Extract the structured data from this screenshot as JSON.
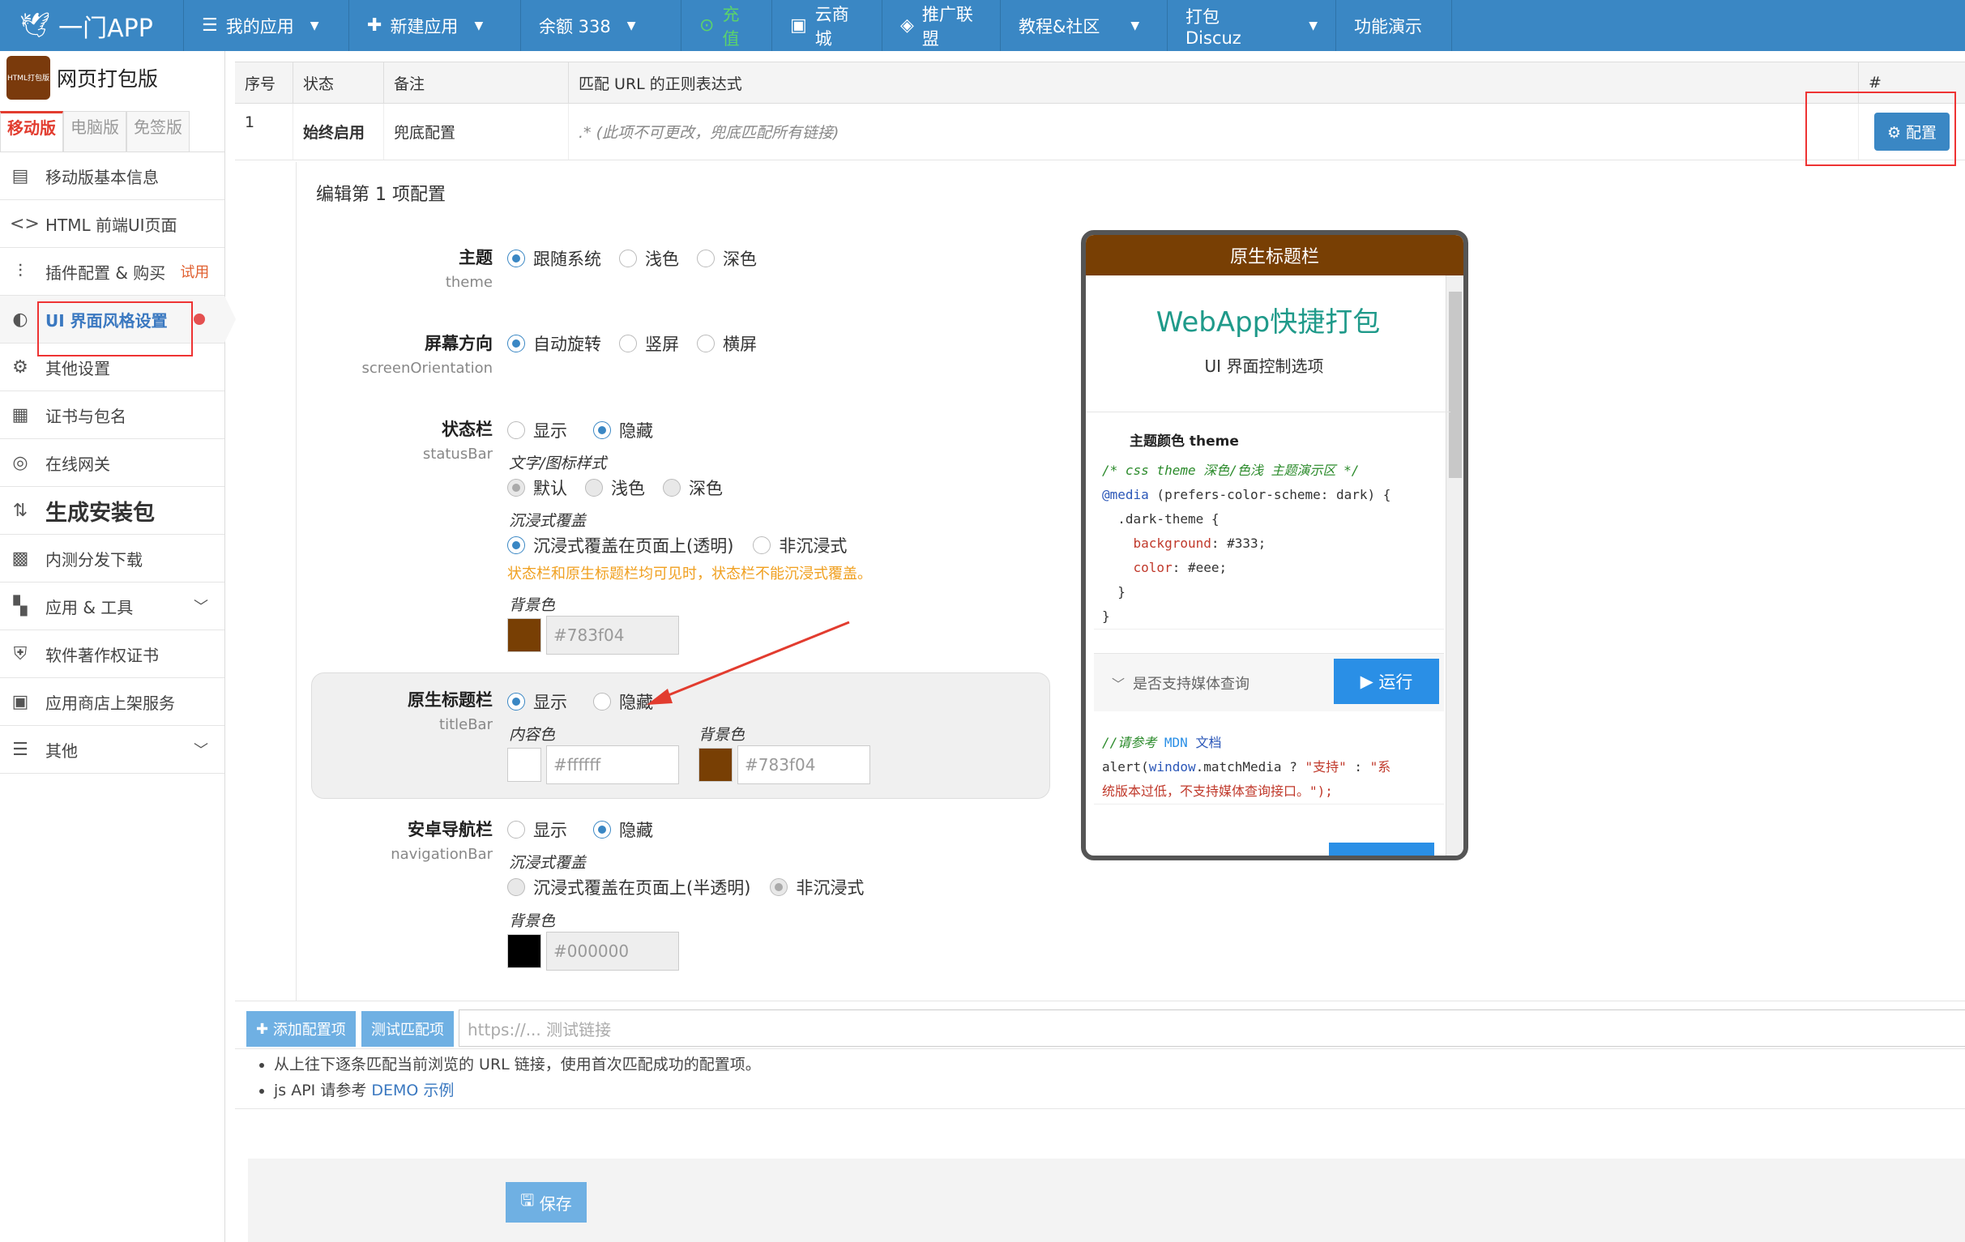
{
  "topnav": {
    "brand": "一门APP",
    "items": [
      {
        "label": "我的应用",
        "icon": "list-icon"
      },
      {
        "label": "新建应用",
        "icon": "plus-icon"
      },
      {
        "label": "余额 338",
        "icon": ""
      },
      {
        "label": "充值",
        "icon": "recharge-icon"
      },
      {
        "label": "云商城",
        "icon": "shop-icon"
      },
      {
        "label": "推广联盟",
        "icon": "diamond-icon"
      },
      {
        "label": "教程&社区",
        "icon": ""
      },
      {
        "label": "打包 Discuz",
        "icon": ""
      },
      {
        "label": "功能演示",
        "icon": ""
      }
    ]
  },
  "sidebar": {
    "app_logo_text": "HTML打包版",
    "app_title": "网页打包版",
    "version_tabs": [
      "移动版",
      "电脑版",
      "免签版"
    ],
    "items": [
      {
        "label": "移动版基本信息",
        "icon": "document-icon"
      },
      {
        "label": "HTML 前端UI页面",
        "icon": "code-icon"
      },
      {
        "label": "插件配置 & 购买",
        "icon": "sliders-icon",
        "badge": "试用"
      },
      {
        "label": "UI 界面风格设置",
        "icon": "palette-icon"
      },
      {
        "label": "其他设置",
        "icon": "gear-icon"
      },
      {
        "label": "证书与包名",
        "icon": "certificate-icon"
      },
      {
        "label": "在线网关",
        "icon": "gateway-icon"
      },
      {
        "label": "生成安装包",
        "icon": "sort-icon"
      },
      {
        "label": "内测分发下载",
        "icon": "qrcode-icon"
      },
      {
        "label": "应用 & 工具",
        "icon": "grid-icon"
      },
      {
        "label": "软件著作权证书",
        "icon": "shield-icon"
      },
      {
        "label": "应用商店上架服务",
        "icon": "store-icon"
      },
      {
        "label": "其他",
        "icon": "menu-icon"
      }
    ]
  },
  "table": {
    "headers": [
      "序号",
      "状态",
      "备注",
      "匹配 URL 的正则表达式",
      "#"
    ],
    "row": {
      "index": "1",
      "status": "始终启用",
      "remark": "兜底配置",
      "regex": ".* (此项不可更改，兜底匹配所有链接)",
      "action": "配置"
    }
  },
  "editor": {
    "title": "编辑第 1 项配置",
    "theme": {
      "label": "主题",
      "key": "theme",
      "options": [
        "跟随系统",
        "浅色",
        "深色"
      ],
      "selected": 0
    },
    "orientation": {
      "label": "屏幕方向",
      "key": "screenOrientation",
      "options": [
        "自动旋转",
        "竖屏",
        "横屏"
      ],
      "selected": 0
    },
    "statusbar": {
      "label": "状态栏",
      "key": "statusBar",
      "options": [
        "显示",
        "隐藏"
      ],
      "selected": 1,
      "text_style_label": "文字/图标样式",
      "text_style_options": [
        "默认",
        "浅色",
        "深色"
      ],
      "immersive_label": "沉浸式覆盖",
      "immersive_options": [
        "沉浸式覆盖在页面上(透明)",
        "非沉浸式"
      ],
      "warning": "状态栏和原生标题栏均可见时，状态栏不能沉浸式覆盖。",
      "bg_label": "背景色",
      "bg_value": "#783f04",
      "bg_color": "#783f04"
    },
    "titlebar": {
      "label": "原生标题栏",
      "key": "titleBar",
      "options": [
        "显示",
        "隐藏"
      ],
      "selected": 0,
      "content_label": "内容色",
      "content_value": "#ffffff",
      "content_color": "#ffffff",
      "bg_label": "背景色",
      "bg_value": "#783f04",
      "bg_color": "#783f04"
    },
    "navbar": {
      "label": "安卓导航栏",
      "key": "navigationBar",
      "options": [
        "显示",
        "隐藏"
      ],
      "selected": 1,
      "immersive_label": "沉浸式覆盖",
      "immersive_options": [
        "沉浸式覆盖在页面上(半透明)",
        "非沉浸式"
      ],
      "bg_label": "背景色",
      "bg_value": "#000000",
      "bg_color": "#000000"
    }
  },
  "preview": {
    "titlebar": "原生标题栏",
    "heading": "WebApp快捷打包",
    "subheading": "UI 界面控制选项",
    "section": "主题颜色 theme",
    "code1": {
      "c1": "/* css theme 深色/色浅 主题演示区 */",
      "c2a": "@media",
      "c2b": " (prefers-color-scheme: dark) {",
      "c3": "  .dark-theme {",
      "c4a": "    background",
      "c4b": ": #333;",
      "c5a": "    color",
      "c5b": ": #eee;",
      "c6": "  }",
      "c7": "}"
    },
    "media_query_label": "是否支持媒体查询",
    "run_label": "运行",
    "code2": {
      "c1a": "//请参考 ",
      "c1b": "MDN",
      "c1c": " 文档",
      "c2a": "alert(",
      "c2b": "window",
      "c2c": ".matchMedia ? ",
      "c2d": "\"支持\"",
      "c2e": " : ",
      "c2f": "\"系",
      "c3": "统版本过低，不支持媒体查询接口。\");"
    }
  },
  "footer": {
    "add_button": "添加配置项",
    "test_button": "测试匹配项",
    "test_placeholder": "https://... 测试链接",
    "note1": "从上往下逐条匹配当前浏览的 URL 链接，使用首次匹配成功的配置项。",
    "note2_prefix": "js API 请参考 ",
    "note2_link": "DEMO 示例",
    "save_button": "保存"
  }
}
